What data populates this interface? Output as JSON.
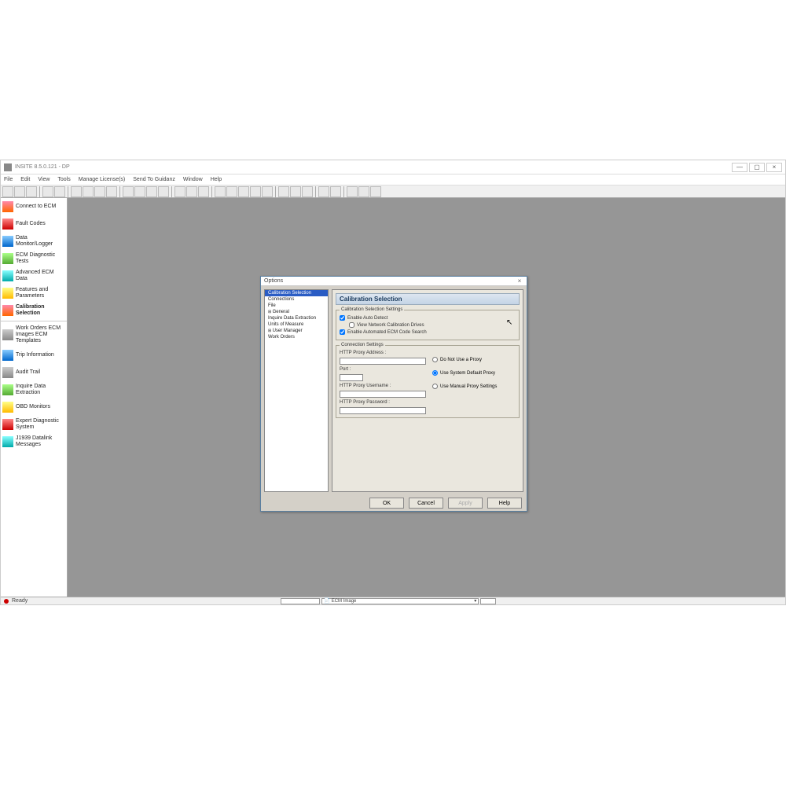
{
  "app": {
    "title": "INSITE 8.5.0.121 - DP",
    "menus": [
      "File",
      "Edit",
      "View",
      "Tools",
      "Manage License(s)",
      "Send To Guidanz",
      "Window",
      "Help"
    ]
  },
  "sidebar": {
    "items": [
      {
        "label": "Connect to ECM"
      },
      {
        "label": "Fault Codes"
      },
      {
        "label": "Data Monitor/Logger"
      },
      {
        "label": "ECM Diagnostic Tests"
      },
      {
        "label": "Advanced ECM Data"
      },
      {
        "label": "Features and Parameters"
      },
      {
        "label": "Calibration Selection"
      },
      {
        "label": "Work Orders ECM Images ECM Templates"
      },
      {
        "label": "Trip Information"
      },
      {
        "label": "Audit Trail"
      },
      {
        "label": "Inquire Data Extraction"
      },
      {
        "label": "OBD Monitors"
      },
      {
        "label": "Expert Diagnostic System"
      },
      {
        "label": "J1939 Datalink Messages"
      }
    ]
  },
  "status": {
    "text": "Ready",
    "dropdown": "ECM Image"
  },
  "dialog": {
    "title": "Options",
    "tree": [
      {
        "label": "Calibration Selection",
        "selected": true
      },
      {
        "label": "Connections"
      },
      {
        "label": "File"
      },
      {
        "label": "General",
        "parent": true
      },
      {
        "label": "Inquire Data Extraction"
      },
      {
        "label": "Units of Measure"
      },
      {
        "label": "User Manager",
        "parent": true
      },
      {
        "label": "Work Orders"
      }
    ],
    "panel_title": "Calibration Selection",
    "group1": {
      "legend": "Calibration Selection Settings",
      "cb1": "Enable Auto Detect",
      "cb2": "View Network Calibration Drives",
      "cb3": "Enable Automated ECM Code Search"
    },
    "group2": {
      "legend": "Connection Settings",
      "proxy_addr": "HTTP Proxy Address :",
      "port": "Port :",
      "proxy_user": "HTTP Proxy Username :",
      "proxy_pass": "HTTP Proxy Password :",
      "r1": "Do Not Use a Proxy",
      "r2": "Use System Default Proxy",
      "r3": "Use Manual Proxy Settings"
    },
    "buttons": {
      "ok": "OK",
      "cancel": "Cancel",
      "apply": "Apply",
      "help": "Help"
    }
  }
}
